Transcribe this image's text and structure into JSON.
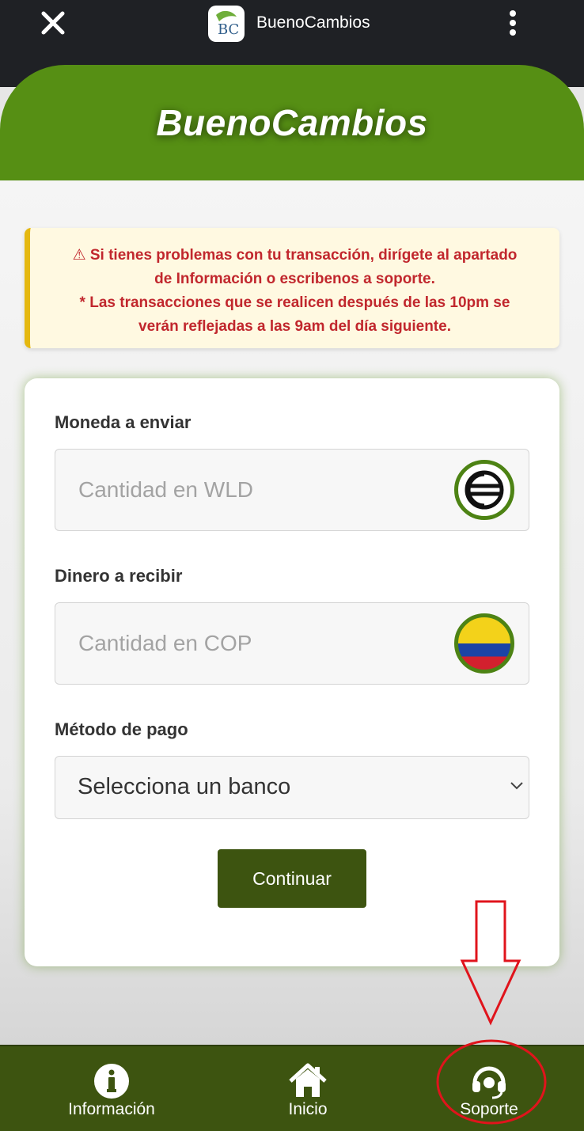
{
  "topbar": {
    "title": "BuenoCambios",
    "logo_text": "BC",
    "close_icon": "close-icon",
    "menu_icon": "kebab-menu-icon"
  },
  "hero": {
    "brand": "BuenoCambios"
  },
  "alert": {
    "lines": [
      "⚠ Si tienes problemas con tu transacción, dirígete al apartado",
      "de Información o escribenos a soporte.",
      "* Las transacciones que se realicen después de las 10pm se",
      "verán reflejadas a las 9am del día siguiente."
    ]
  },
  "form": {
    "send_label": "Moneda a enviar",
    "send_placeholder": "Cantidad en WLD",
    "send_icon": "worldcoin-icon",
    "receive_label": "Dinero a recibir",
    "receive_placeholder": "Cantidad en COP",
    "receive_icon": "colombia-flag-icon",
    "payment_label": "Método de pago",
    "payment_selected": "Selecciona un banco",
    "continue_label": "Continuar"
  },
  "bottom_nav": {
    "items": [
      {
        "label": "Información",
        "icon": "info-icon"
      },
      {
        "label": "Inicio",
        "icon": "home-icon"
      },
      {
        "label": "Soporte",
        "icon": "headset-icon"
      }
    ]
  },
  "colors": {
    "brand_green": "#568f14",
    "dark_green": "#3d5410",
    "alert_text": "#c1272d",
    "alert_bg": "#fff9e1",
    "annotation_red": "#e0141c"
  }
}
